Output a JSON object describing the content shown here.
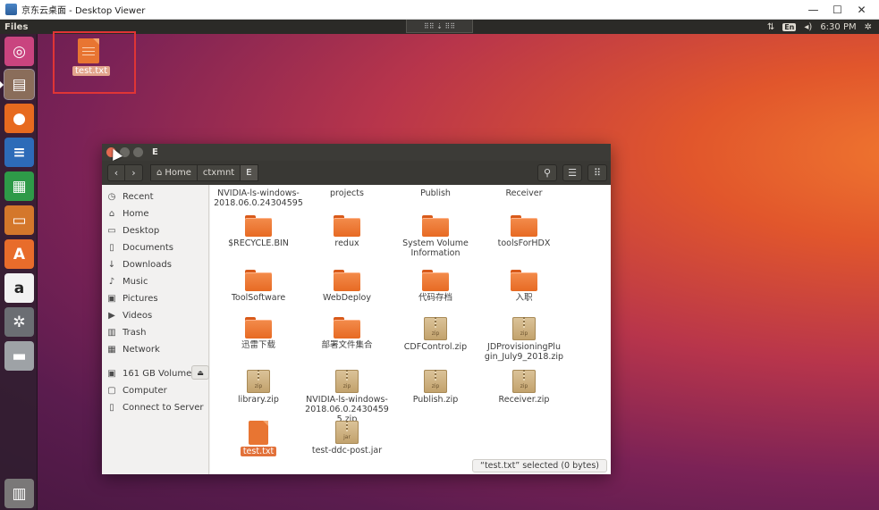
{
  "viewer": {
    "title": "京东云桌面 - Desktop Viewer",
    "minimize": "—",
    "maximize": "☐",
    "close": "✕"
  },
  "topbar": {
    "app_name": "Files",
    "lang": "En",
    "time": "6:30 PM",
    "grip": "⠿⠿ ⇣ ⠿⠿"
  },
  "launcher": {
    "items": [
      {
        "name": "ubuntu-dash",
        "glyph": "◎"
      },
      {
        "name": "files",
        "glyph": "▤"
      },
      {
        "name": "firefox",
        "glyph": "●"
      },
      {
        "name": "libreoffice-writer",
        "glyph": "≡"
      },
      {
        "name": "libreoffice-calc",
        "glyph": "▦"
      },
      {
        "name": "libreoffice-impress",
        "glyph": "▭"
      },
      {
        "name": "software-center",
        "glyph": "A"
      },
      {
        "name": "amazon",
        "glyph": "a"
      },
      {
        "name": "system-settings",
        "glyph": "✲"
      },
      {
        "name": "drive",
        "glyph": "▬"
      },
      {
        "name": "trash",
        "glyph": "▥"
      }
    ]
  },
  "desktop": {
    "file_label": "test.txt"
  },
  "window": {
    "title": "E",
    "back": "‹",
    "forward": "›",
    "breadcrumbs": [
      "Home",
      "ctxmnt",
      "E"
    ],
    "search_glyph": "⚲",
    "list_glyph": "☰",
    "grid_glyph": "⠿"
  },
  "sidebar": {
    "places": [
      {
        "label": "Recent",
        "icon": "◷"
      },
      {
        "label": "Home",
        "icon": "⌂"
      },
      {
        "label": "Desktop",
        "icon": "▭"
      },
      {
        "label": "Documents",
        "icon": "▯"
      },
      {
        "label": "Downloads",
        "icon": "↓"
      },
      {
        "label": "Music",
        "icon": "♪"
      },
      {
        "label": "Pictures",
        "icon": "▣"
      },
      {
        "label": "Videos",
        "icon": "▶"
      },
      {
        "label": "Trash",
        "icon": "▥"
      },
      {
        "label": "Network",
        "icon": "▦"
      }
    ],
    "devices": [
      {
        "label": "161 GB Volume",
        "icon": "▣",
        "eject": "⏏"
      },
      {
        "label": "Computer",
        "icon": "▢"
      },
      {
        "label": "Connect to Server",
        "icon": "▯"
      }
    ]
  },
  "files": [
    {
      "label": "NVIDIA-ls-windows-\n2018.06.0.24304595",
      "type": "none"
    },
    {
      "label": "projects",
      "type": "none"
    },
    {
      "label": "Publish",
      "type": "none"
    },
    {
      "label": "Receiver",
      "type": "none"
    },
    {
      "label": "$RECYCLE.BIN",
      "type": "folder"
    },
    {
      "label": "redux",
      "type": "folder"
    },
    {
      "label": "System Volume\nInformation",
      "type": "folder"
    },
    {
      "label": "toolsForHDX",
      "type": "folder"
    },
    {
      "label": "ToolSoftware",
      "type": "folder"
    },
    {
      "label": "WebDeploy",
      "type": "folder"
    },
    {
      "label": "代码存档",
      "type": "folder"
    },
    {
      "label": "入职",
      "type": "folder"
    },
    {
      "label": "迅雷下载",
      "type": "folder"
    },
    {
      "label": "部署文件集合",
      "type": "folder"
    },
    {
      "label": "CDFControl.zip",
      "type": "zip"
    },
    {
      "label": "JDProvisioningPlu\ngin_July9_2018.zip",
      "type": "zip"
    },
    {
      "label": "library.zip",
      "type": "zip"
    },
    {
      "label": "NVIDIA-ls-windows-\n2018.06.0.2430459\n5.zip",
      "type": "zip"
    },
    {
      "label": "Publish.zip",
      "type": "zip"
    },
    {
      "label": "Receiver.zip",
      "type": "zip"
    },
    {
      "label": "test.txt",
      "type": "txt",
      "selected": true
    },
    {
      "label": "test-ddc-post.jar",
      "type": "jar"
    }
  ],
  "zip_tag": "zip",
  "jar_tag": "jar",
  "status": "“test.txt” selected (0 bytes)"
}
